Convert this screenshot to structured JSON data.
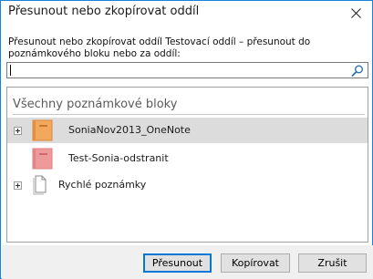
{
  "dialog": {
    "title": "Přesunout nebo zkopírovat oddíl",
    "instruction": "Přesunout nebo zkopírovat oddíl Testovací oddíl – přesunout do poznámkového bloku nebo za oddíl:"
  },
  "search": {
    "value": "",
    "placeholder": ""
  },
  "tree": {
    "root_label": "Všechny poznámkové bloky",
    "items": [
      {
        "label": "SoniaNov2013_OneNote",
        "icon": "notebook-icon",
        "color": "#f2a85d",
        "expandable": true,
        "selected": true
      },
      {
        "label": "Test-Sonia-odstranit",
        "icon": "notebook-icon",
        "color": "#ef9a9a",
        "expandable": false,
        "selected": false
      },
      {
        "label": "Rychlé poznámky",
        "icon": "quick-notes-page-icon",
        "expandable": true,
        "selected": false
      }
    ]
  },
  "buttons": {
    "move": "Přesunout",
    "copy": "Kopírovat",
    "cancel": "Zrušit"
  },
  "colors": {
    "accent": "#0078d7",
    "selection": "#dcdcdc",
    "notebook_orange": "#f2a85d",
    "notebook_pink": "#ef9a9a"
  }
}
